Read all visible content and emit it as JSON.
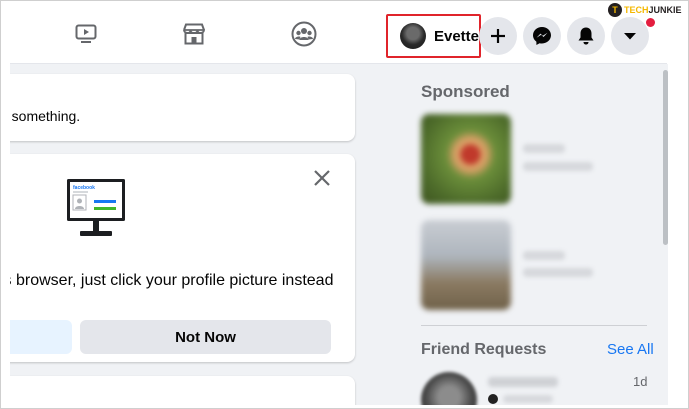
{
  "header": {
    "nav": [
      {
        "icon": "watch-icon"
      },
      {
        "icon": "marketplace-icon"
      },
      {
        "icon": "groups-icon"
      }
    ],
    "profile": {
      "name": "Evette"
    },
    "actions": [
      {
        "icon": "plus-icon"
      },
      {
        "icon": "messenger-icon"
      },
      {
        "icon": "notifications-bell-icon"
      },
      {
        "icon": "account-menu-caret-icon"
      }
    ]
  },
  "watermark": {
    "letter": "T",
    "brand_a": "TECH",
    "brand_b": "JUNKIE"
  },
  "feed": {
    "post_prompt_text": "e something.",
    "login_tip_card": {
      "message": "is browser, just click your profile picture instead",
      "secondary_button": "Not Now",
      "illustration_label": "facebook"
    }
  },
  "right_column": {
    "sponsored_title": "Sponsored",
    "friend_requests": {
      "title": "Friend Requests",
      "see_all": "See All",
      "first_request_time": "1d"
    }
  },
  "colors": {
    "highlight_border": "#e0242b",
    "link_blue": "#1877f2",
    "notification_red": "#e41e3f",
    "page_background": "#f0f2f5"
  }
}
